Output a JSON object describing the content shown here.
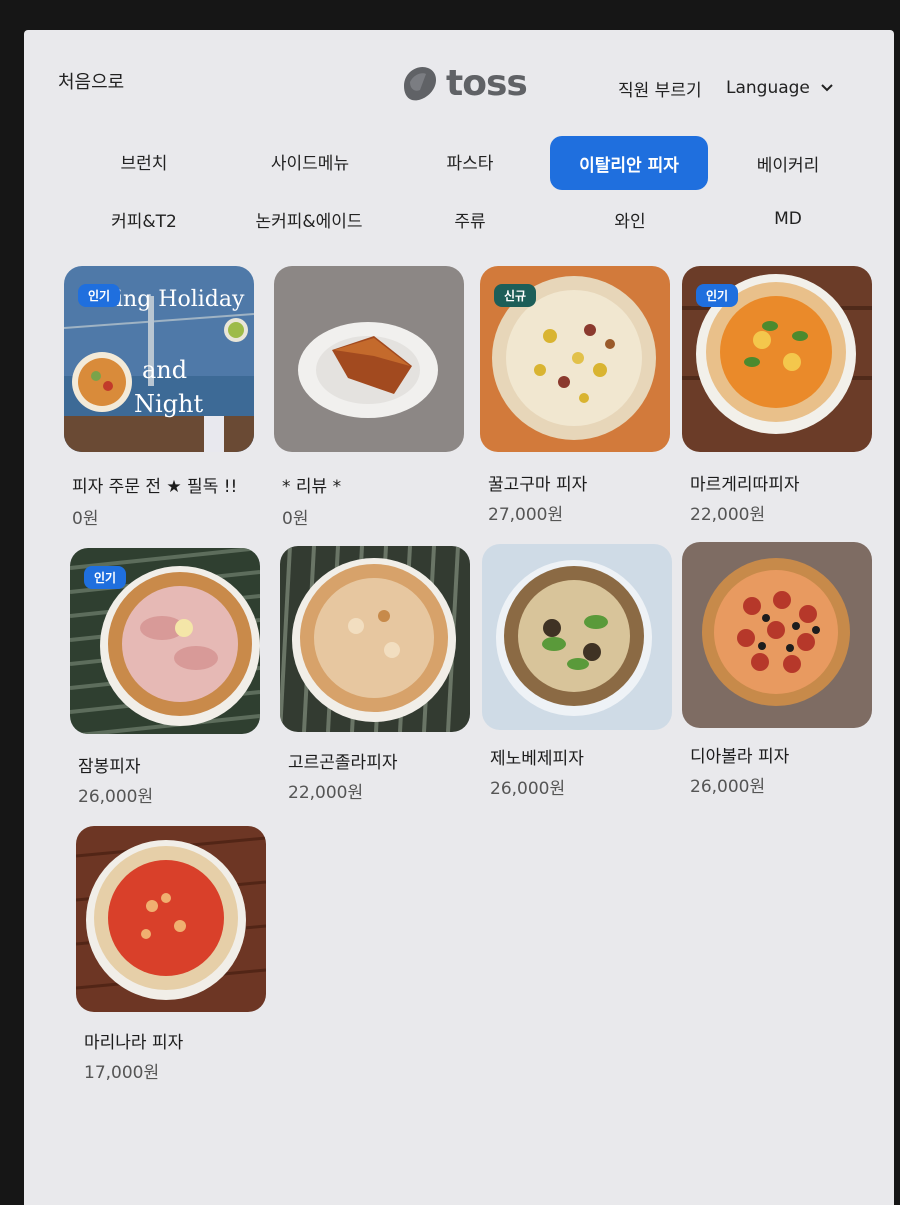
{
  "header": {
    "home_label": "처음으로",
    "logo_text": "toss",
    "call_staff_label": "직원 부르기",
    "language_label": "Language"
  },
  "tabs": [
    {
      "label": "브런치",
      "active": false
    },
    {
      "label": "사이드메뉴",
      "active": false
    },
    {
      "label": "파스타",
      "active": false
    },
    {
      "label": "이탈리안 피자",
      "active": true
    },
    {
      "label": "베이커리",
      "active": false
    },
    {
      "label": "커피&T2",
      "active": false
    },
    {
      "label": "논커피&에이드",
      "active": false
    },
    {
      "label": "주류",
      "active": false
    },
    {
      "label": "와인",
      "active": false
    },
    {
      "label": "MD",
      "active": false
    }
  ],
  "items": [
    {
      "name": "피자 주문 전 ★ 필독 !!",
      "price": "0원",
      "badge": "인기",
      "image_text": [
        "ing Holiday",
        "and",
        "Night"
      ]
    },
    {
      "name": "* 리뷰 *",
      "price": "0원",
      "badge": ""
    },
    {
      "name": "꿀고구마 피자",
      "price": "27,000원",
      "badge": "신규"
    },
    {
      "name": "마르게리따피자",
      "price": "22,000원",
      "badge": "인기"
    },
    {
      "name": "잠봉피자",
      "price": "26,000원",
      "badge": "인기"
    },
    {
      "name": "고르곤졸라피자",
      "price": "22,000원",
      "badge": ""
    },
    {
      "name": "제노베제피자",
      "price": "26,000원",
      "badge": ""
    },
    {
      "name": "디아볼라 피자",
      "price": "26,000원",
      "badge": ""
    },
    {
      "name": "마리나라 피자",
      "price": "17,000원",
      "badge": ""
    }
  ],
  "colors": {
    "accent": "#1f6fde",
    "new_badge": "#1d5e58",
    "screen_bg": "#e9e9ec",
    "logo_gray": "#606266"
  },
  "icons": [
    "toss-logo-icon",
    "chevron-down-icon"
  ]
}
